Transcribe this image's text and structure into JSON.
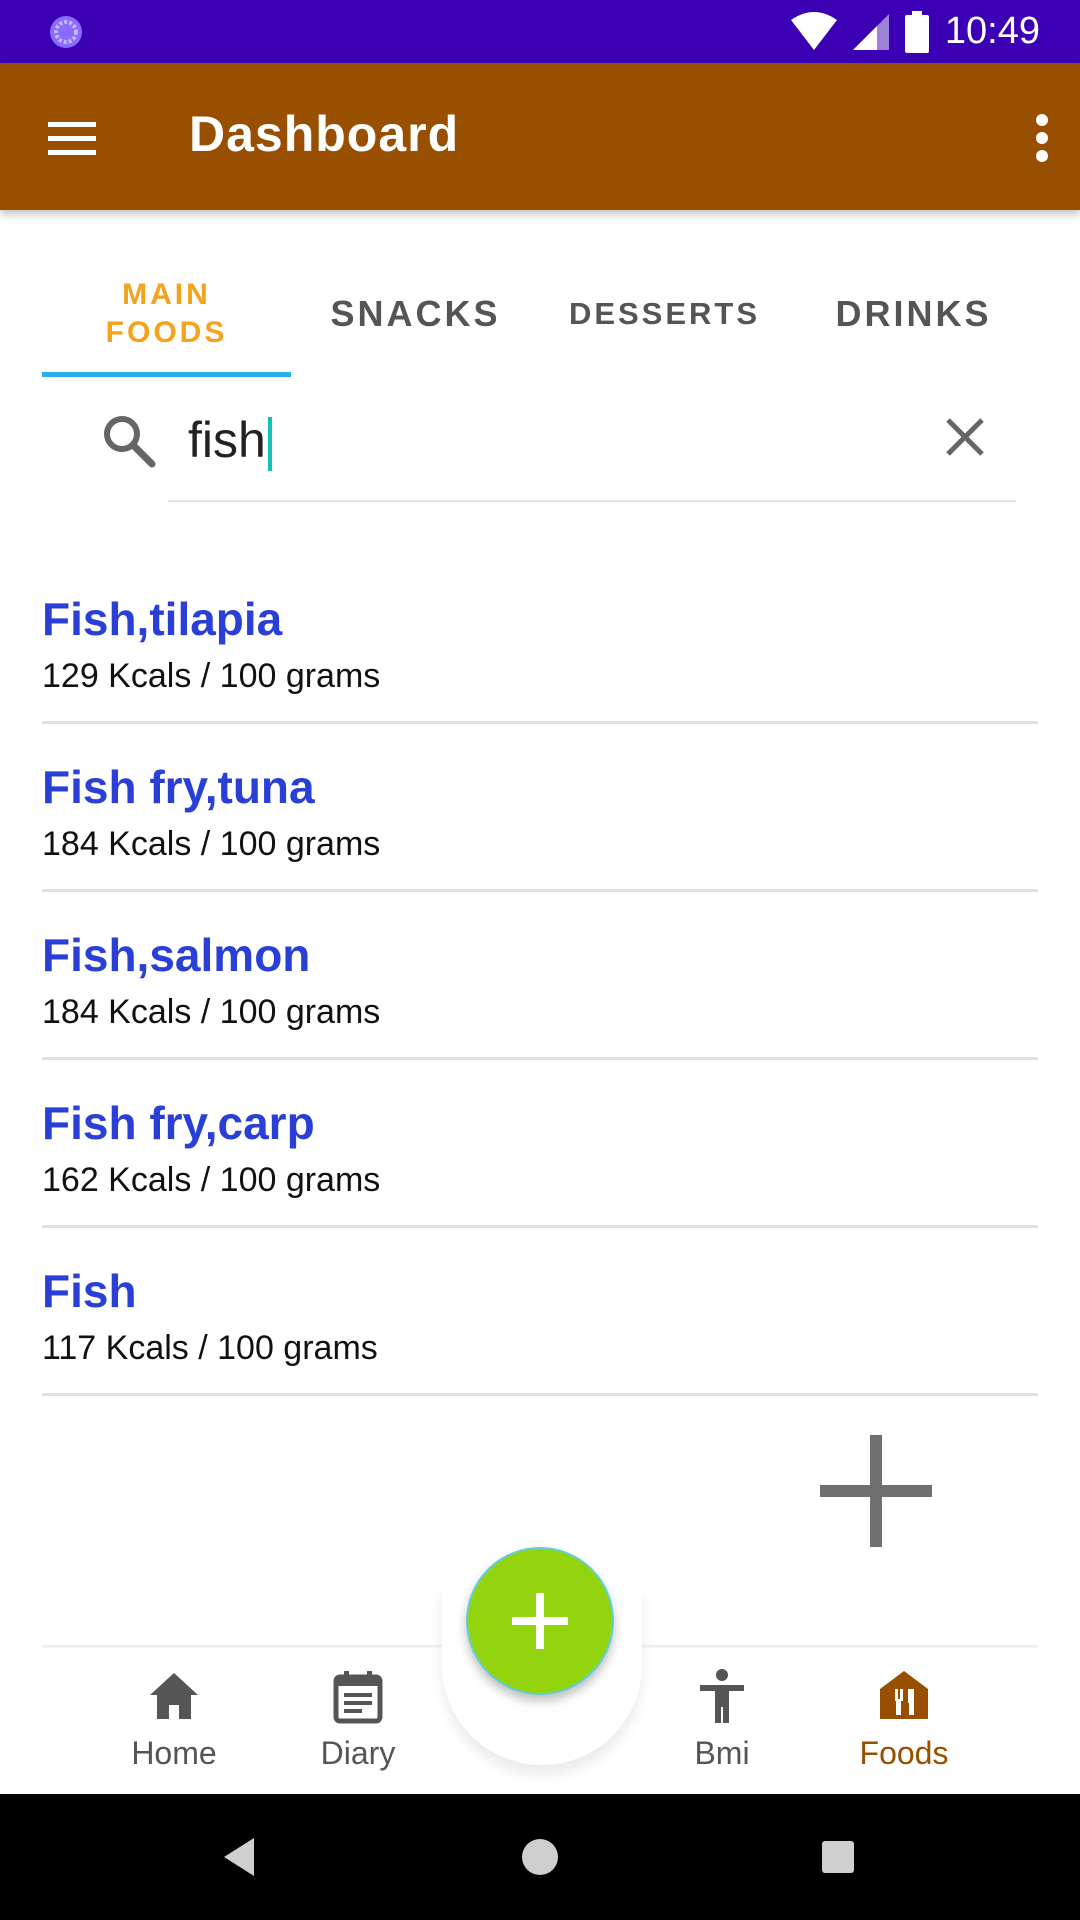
{
  "status_bar": {
    "time": "10:49",
    "icons": [
      "app-notification-icon",
      "wifi-icon",
      "signal-icon",
      "battery-icon"
    ]
  },
  "app_bar": {
    "title": "Dashboard",
    "menu_icon": "hamburger-menu-icon",
    "overflow_icon": "more-vert-icon",
    "color": "#984f00"
  },
  "tabs": [
    {
      "label": "MAIN\nFOODS",
      "active": true
    },
    {
      "label": "SNACKS",
      "active": false
    },
    {
      "label": "DESSERTS",
      "active": false
    },
    {
      "label": "DRINKS",
      "active": false
    }
  ],
  "search": {
    "value": "fish",
    "search_icon": "search-icon",
    "clear_icon": "close-icon"
  },
  "foods": [
    {
      "name": "Fish,tilapia",
      "kcal": "129 Kcals / 100 grams"
    },
    {
      "name": "Fish fry,tuna",
      "kcal": "184 Kcals / 100 grams"
    },
    {
      "name": "Fish,salmon",
      "kcal": "184 Kcals / 100 grams"
    },
    {
      "name": "Fish fry,carp",
      "kcal": "162 Kcals / 100 grams"
    },
    {
      "name": "Fish",
      "kcal": "117 Kcals / 100 grams"
    }
  ],
  "add_food_icon": "plus-icon",
  "bottom_nav": {
    "items": [
      {
        "label": "Home",
        "icon": "home-icon",
        "active": false
      },
      {
        "label": "Diary",
        "icon": "calendar-icon",
        "active": false
      },
      {
        "label": "Bmi",
        "icon": "accessibility-icon",
        "active": false
      },
      {
        "label": "Foods",
        "icon": "restaurant-icon",
        "active": true
      }
    ],
    "fab_icon": "plus-icon",
    "fab_color": "#94d40f",
    "active_color": "#984f00"
  },
  "system_nav": [
    "back-icon",
    "home-circle-icon",
    "recents-icon"
  ]
}
